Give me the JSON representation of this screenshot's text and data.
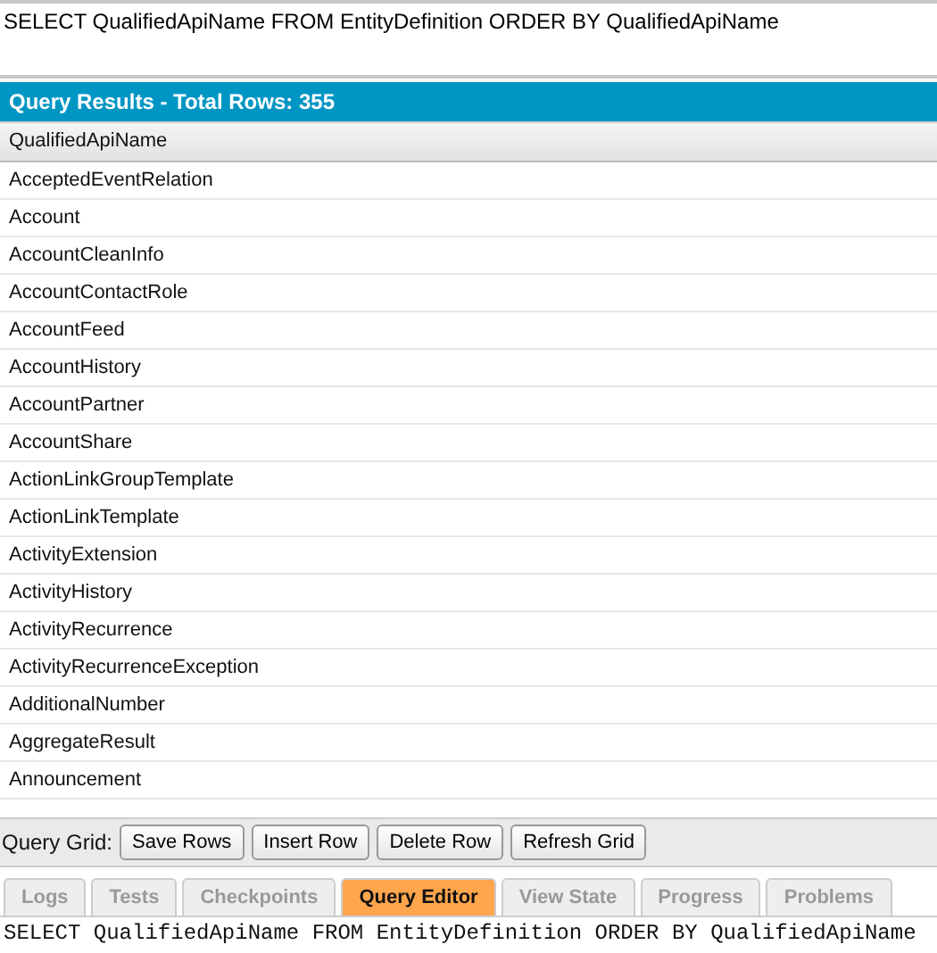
{
  "query_editor": {
    "value": "SELECT QualifiedApiName FROM EntityDefinition ORDER BY QualifiedApiName"
  },
  "results": {
    "title": "Query Results - Total Rows: 355",
    "columns": [
      "QualifiedApiName"
    ],
    "rows": [
      "AcceptedEventRelation",
      "Account",
      "AccountCleanInfo",
      "AccountContactRole",
      "AccountFeed",
      "AccountHistory",
      "AccountPartner",
      "AccountShare",
      "ActionLinkGroupTemplate",
      "ActionLinkTemplate",
      "ActivityExtension",
      "ActivityHistory",
      "ActivityRecurrence",
      "ActivityRecurrenceException",
      "AdditionalNumber",
      "AggregateResult",
      "Announcement"
    ]
  },
  "grid_toolbar": {
    "label": "Query Grid:",
    "buttons": [
      "Save Rows",
      "Insert Row",
      "Delete Row",
      "Refresh Grid"
    ]
  },
  "tabs": [
    {
      "label": "Logs",
      "selected": false
    },
    {
      "label": "Tests",
      "selected": false
    },
    {
      "label": "Checkpoints",
      "selected": false
    },
    {
      "label": "Query Editor",
      "selected": true
    },
    {
      "label": "View State",
      "selected": false
    },
    {
      "label": "Progress",
      "selected": false
    },
    {
      "label": "Problems",
      "selected": false
    }
  ],
  "bottom_query": "SELECT QualifiedApiName FROM EntityDefinition ORDER BY QualifiedApiName"
}
